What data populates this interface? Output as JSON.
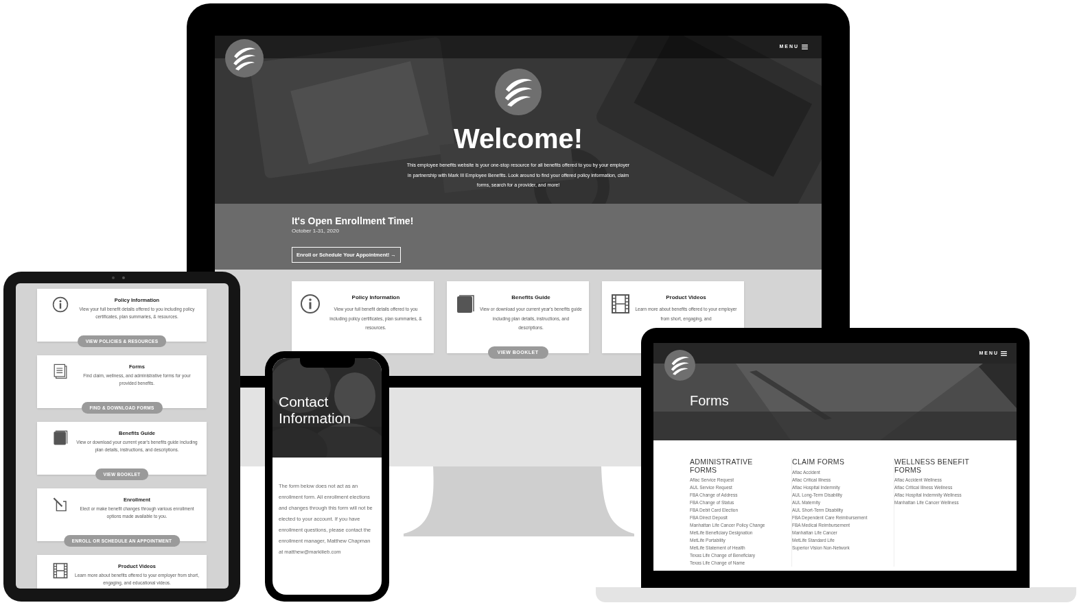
{
  "desktop": {
    "menu_label": "MENU",
    "hero_title": "Welcome!",
    "hero_text": "This employee benefits website is your one-stop resource for all benefits offered to you by your employer in partnership with Mark III Employee Benefits.  Look around to find your offered policy information, claim forms, search for a provider, and more!",
    "enrollment": {
      "title": "It's Open Enrollment Time!",
      "dates": "October 1-31, 2020",
      "button": "Enroll or Schedule Your Appointment! →"
    },
    "cards": [
      {
        "kind": "info",
        "title": "Policy Information",
        "text": "View your full benefit details offered to you including policy certificates, plan summaries, & resources."
      },
      {
        "kind": "book",
        "title": "Benefits Guide",
        "text": "View or download your current year's benefits guide including plan details, instructions, and descriptions.",
        "button_label": "VIEW BOOKLET"
      },
      {
        "kind": "film",
        "title": "Product Videos",
        "text": "Learn more about benefits offered to your employer from short, engaging, and"
      }
    ]
  },
  "tablet": {
    "cards": [
      {
        "kind": "info",
        "title": "Policy Information",
        "text": "View your full benefit details offered to you including policy certificates, plan summaries, & resources.",
        "button_label": "VIEW POLICIES & RESOURCES"
      },
      {
        "kind": "document",
        "title": "Forms",
        "text": "Find claim, wellness, and administrative forms for your provided benefits.",
        "button_label": "FIND & DOWNLOAD FORMS"
      },
      {
        "kind": "book",
        "title": "Benefits Guide",
        "text": "View or download your current year's benefits guide including plan details, instructions, and descriptions.",
        "button_label": "VIEW BOOKLET"
      },
      {
        "kind": "enroll",
        "title": "Enrollment",
        "text": "Elect or make benefit changes through various enrollment options made available to you.",
        "button_label": "ENROLL OR SCHEDULE AN APPOINTMENT"
      },
      {
        "kind": "film",
        "title": "Product Videos",
        "text": "Learn more about benefits offered to your employer from short, engaging, and educational videos."
      }
    ]
  },
  "phone": {
    "title": "Contact Information",
    "text": "The form below does not act as an enrollment form. All enrollment elections and changes through this form will not be elected to your account. If you have enrollment questions, please contact the enrollment manager, Matthew Chapman at matthew@markiiieb.com"
  },
  "laptop": {
    "menu_label": "MENU",
    "title": "Forms",
    "columns": [
      {
        "heading": "ADMINISTRATIVE FORMS",
        "items": [
          "Aflac Service Request",
          "AUL Service Request",
          "FBA Change of Address",
          "FBA Change of Status",
          "FBA Debit Card Election",
          "FBA Direct Deposit",
          "Manhattan Life Cancer Policy Change",
          "MetLife Beneficiary Designation",
          "MetLife Portability",
          "MetLife Statement of Health",
          "Texas Life Change of Beneficiary",
          "Texas Life Change of Name"
        ]
      },
      {
        "heading": "CLAIM FORMS",
        "items": [
          "Aflac Accident",
          "Aflac Critical Illness",
          "Aflac Hospital Indemnity",
          "AUL Long-Term Disability",
          "AUL Maternity",
          "AUL Short-Term Disability",
          "FBA Dependent Care Reimbursement",
          "FBA Medical Reimbursement",
          "Manhattan Life Cancer",
          "MetLife Standard Life",
          "Superior Vision Non-Network"
        ]
      },
      {
        "heading": "WELLNESS BENEFIT FORMS",
        "items": [
          "Aflac Accident Wellness",
          "Aflac Critical Illness Wellness",
          "Aflac Hospital Indemnity Wellness",
          "Manhattan Life Cancer Wellness"
        ]
      }
    ]
  }
}
